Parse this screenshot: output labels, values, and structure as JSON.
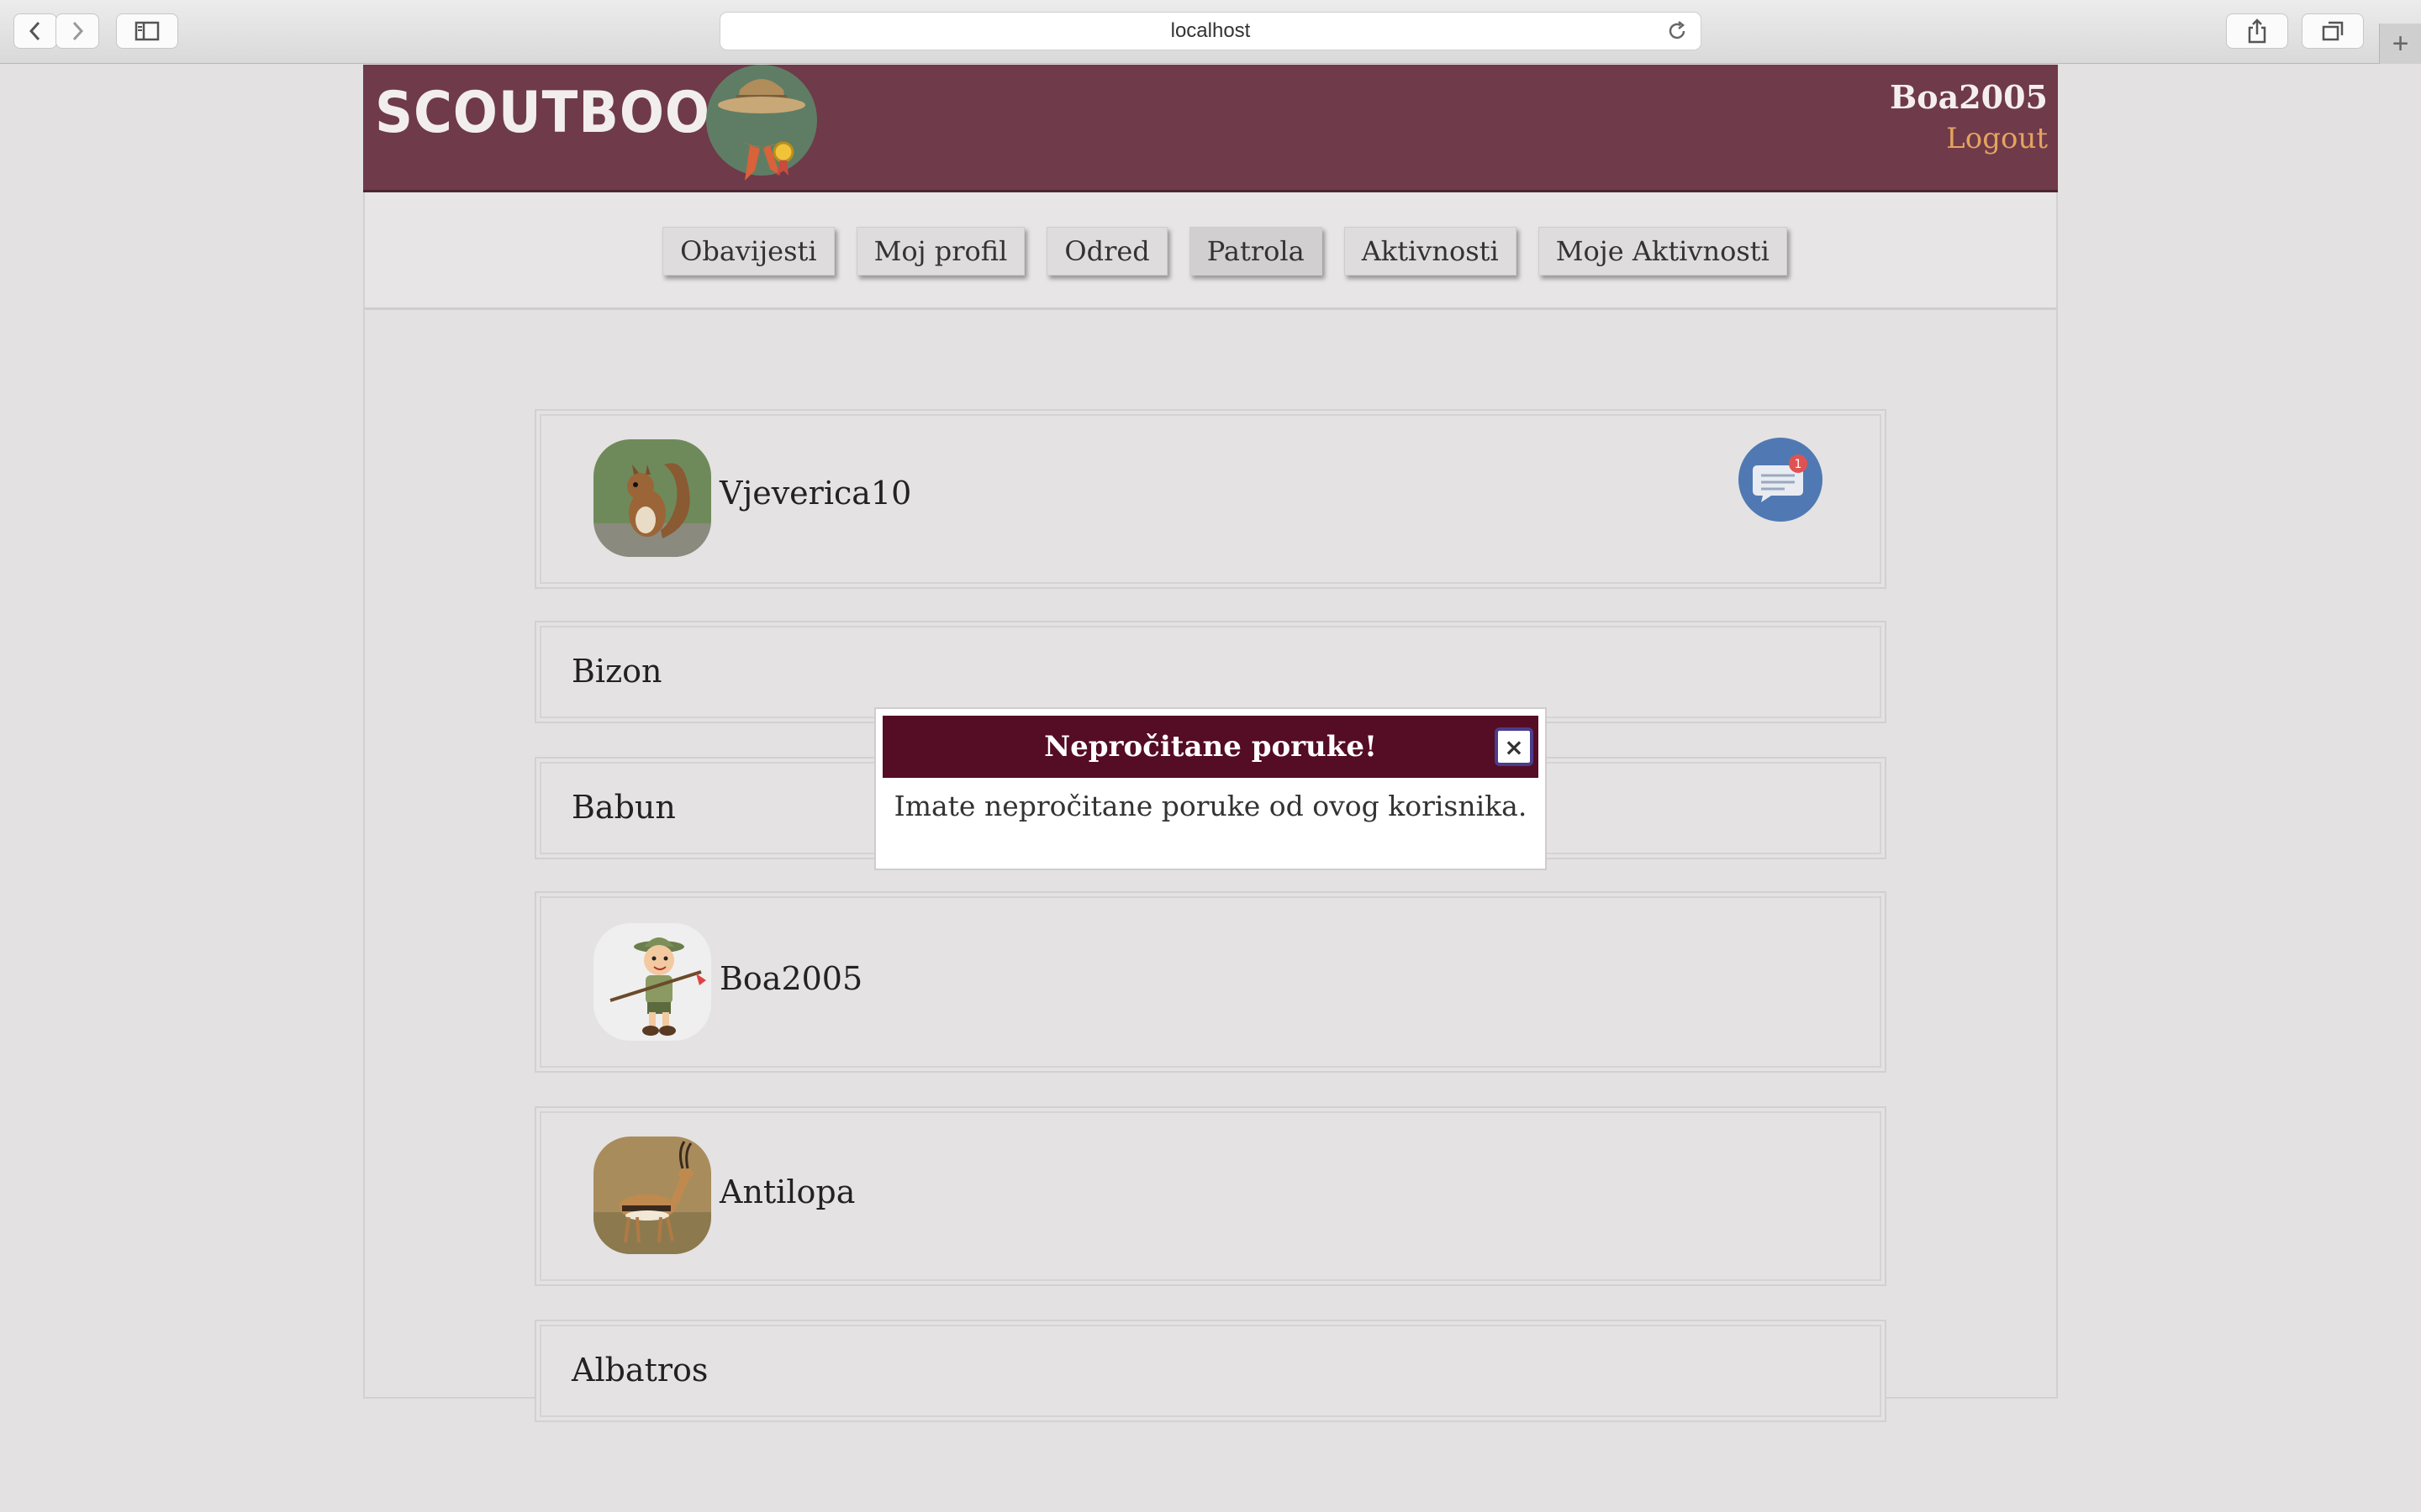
{
  "browser": {
    "url": "localhost"
  },
  "header": {
    "logo_text": "SCOUTBOOK",
    "username": "Boa2005",
    "logout_label": "Logout"
  },
  "nav": {
    "items": [
      "Obavijesti",
      "Moj profil",
      "Odred",
      "Patrola",
      "Aktivnosti",
      "Moje Aktivnosti"
    ],
    "active": "Patrola"
  },
  "members": [
    {
      "name": "Vjeverica10",
      "avatar": "squirrel",
      "unread": "1"
    },
    {
      "name": "Bizon"
    },
    {
      "name": "Babun"
    },
    {
      "name": "Boa2005",
      "avatar": "scout-cartoon"
    },
    {
      "name": "Antilopa",
      "avatar": "antelope"
    },
    {
      "name": "Albatros"
    }
  ],
  "modal": {
    "title": "Nepročitane poruke!",
    "close_label": "×",
    "message": "Imate nepročitane poruke od ovog korisnika."
  },
  "colors": {
    "header_bg": "#6f3a4a",
    "modal_header_bg": "#550c25",
    "logout_color": "#e4a35f",
    "chat_button": "#5079b3",
    "badge": "#e05252"
  },
  "icons": [
    "back-icon",
    "forward-icon",
    "sidebar-icon",
    "reload-icon",
    "share-icon",
    "tabs-icon",
    "new-tab-icon",
    "chat-icon",
    "close-icon"
  ]
}
